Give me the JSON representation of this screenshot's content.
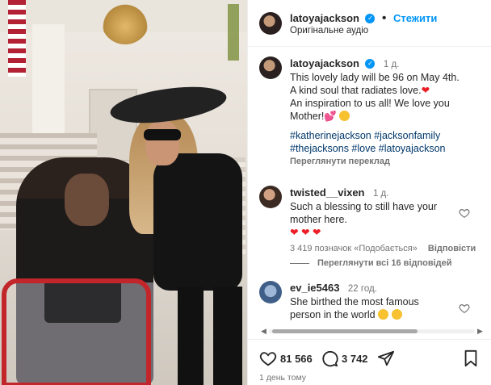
{
  "header": {
    "username": "latoyajackson",
    "follow_label": "Стежити",
    "audio_label": "Оригінальне аудіо"
  },
  "caption": {
    "username": "latoyajackson",
    "time": "1 д.",
    "lines": [
      "This lovely lady will be 96 on May 4th.",
      "A kind soul that radiates love.",
      "An inspiration to us all! We love you",
      "Mother!"
    ],
    "hashtags_line1": "#katherinejackson #jacksonfamily",
    "hashtags_line2": "#thejacksons #love #latoyajackson",
    "translate_label": "Переглянути переклад"
  },
  "comments": [
    {
      "username": "twisted__vixen",
      "time": "1 д.",
      "line1": "Such a blessing to still have your",
      "line2": "mother here.",
      "hearts": "❤ ❤ ❤",
      "likes": "3 419 позначок «Подобається»",
      "reply_label": "Відповісти",
      "view_replies": "Переглянути всі 16 відповідей"
    },
    {
      "username": "ev_ie5463",
      "time": "22 год.",
      "line1": "She birthed the most famous",
      "line2": "person in the world"
    }
  ],
  "actions": {
    "likes_count": "81 566",
    "comments_count": "3 742"
  },
  "posted_ago": "1 день тому",
  "icons": {
    "verified": "verified-badge-icon",
    "heart": "heart-icon",
    "comment": "comment-icon",
    "share": "share-icon",
    "save": "bookmark-icon"
  },
  "colors": {
    "link": "#0095f6",
    "hashtag": "#00376b",
    "secondary": "#737373",
    "heart": "#ed1c24"
  }
}
